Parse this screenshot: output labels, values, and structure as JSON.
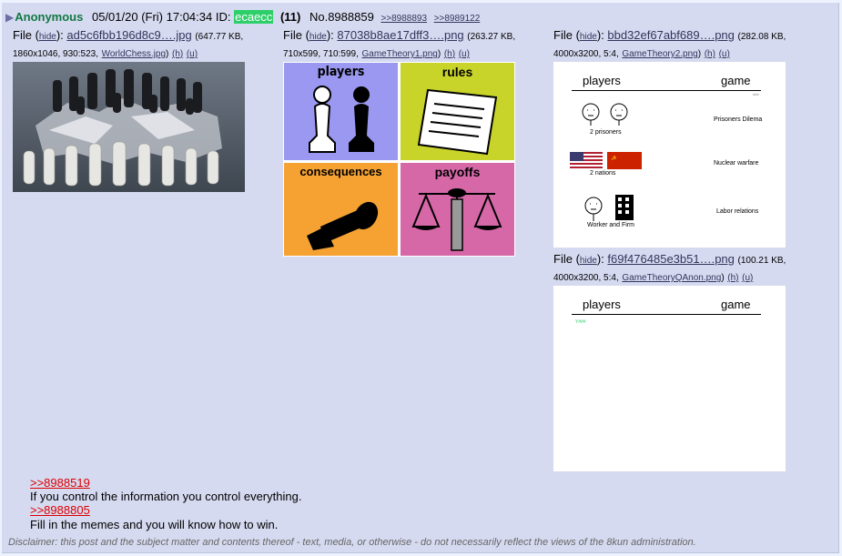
{
  "post": {
    "arrow": "▶",
    "name": "Anonymous",
    "date": "05/01/20 (Fri) 17:04:34",
    "id_label": "ID:",
    "id": "ecaecc",
    "count": "(11)",
    "number": "No.8988859",
    "backlinks": [
      ">>8988893",
      ">>8989122"
    ]
  },
  "files": [
    {
      "label": "File",
      "hide": "hide",
      "name": "ad5c6fbb196d8c9….jpg",
      "meta_line1": "(647.77 KB,",
      "meta_line2": "1860x1046, 930:523,",
      "original": "WorldChess.jpg",
      "h": "(h)",
      "u": "(u)"
    },
    {
      "label": "File",
      "hide": "hide",
      "name": "87038b8ae17dff3….png",
      "meta_line1": "(263.27 KB,",
      "meta_line2": "710x599, 710:599,",
      "original": "GameTheory1.png",
      "h": "(h)",
      "u": "(u)"
    },
    {
      "label": "File",
      "hide": "hide",
      "name": "bbd32ef67abf689….png",
      "meta_line1": "(282.08 KB,",
      "meta_line2": "4000x3200, 5:4,",
      "original": "GameTheory2.png",
      "h": "(h)",
      "u": "(u)"
    },
    {
      "label": "File",
      "hide": "hide",
      "name": "f69f476485e3b51….png",
      "meta_line1": "(100.21 KB,",
      "meta_line2": "4000x3200, 5:4,",
      "original": "GameTheoryQAnon.png",
      "h": "(h)",
      "u": "(u)"
    }
  ],
  "thumb2": {
    "players": "players",
    "rules": "rules",
    "consequences": "consequences",
    "payoffs": "payoffs",
    "colors": {
      "players": "#9a98f0",
      "rules": "#c9d42a",
      "consequences": "#f5a233",
      "payoffs": "#d668a8"
    }
  },
  "thumb3": {
    "head_left": "players",
    "head_right": "game",
    "tiny": "###",
    "rows": [
      {
        "caption": "2 prisoners",
        "game": "Prisoners Dilema"
      },
      {
        "caption": "2 nations",
        "game": "Nuclear warfare"
      },
      {
        "caption": "Worker and Firm",
        "game": "Labor relations"
      }
    ]
  },
  "thumb4": {
    "head_left": "players",
    "head_right": "game",
    "tiny": "Y###"
  },
  "message": {
    "quote1": ">>8988519",
    "line1": "If you control the information you control everything.",
    "quote2": ">>8988805",
    "line2": "Fill in the memes and you will know how to win."
  },
  "disclaimer": "Disclaimer: this post and the subject matter and contents thereof - text, media, or otherwise - do not necessarily reflect the views of the 8kun administration."
}
